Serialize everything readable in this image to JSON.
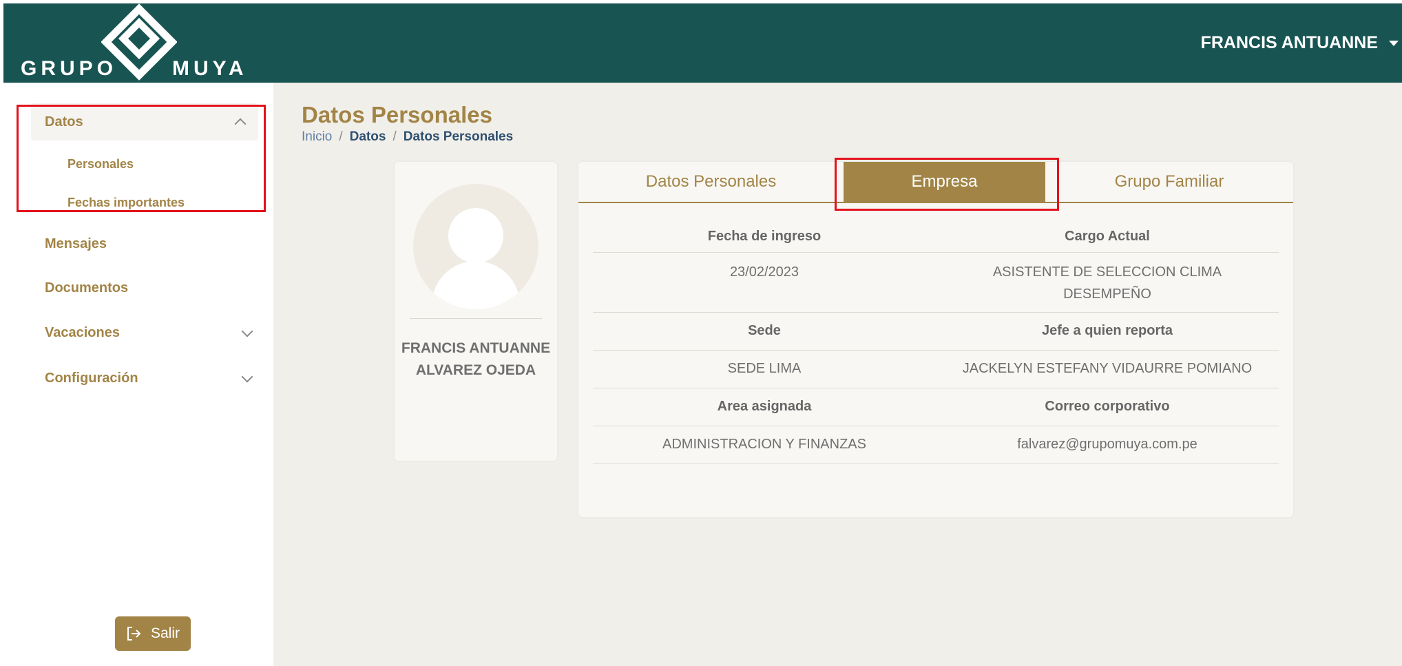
{
  "header": {
    "logo_left": "GRUPO",
    "logo_right": "MUYA",
    "user_name": "FRANCIS ANTUANNE",
    "bg_color": "#185452"
  },
  "sidebar": {
    "group": {
      "label": "Datos",
      "expanded": true
    },
    "subitems": [
      "Personales",
      "Fechas importantes"
    ],
    "items": [
      {
        "label": "Mensajes",
        "has_chevron": false
      },
      {
        "label": "Documentos",
        "has_chevron": false
      },
      {
        "label": "Vacaciones",
        "has_chevron": true
      },
      {
        "label": "Configuración",
        "has_chevron": true
      }
    ],
    "logout_label": "Salir"
  },
  "main": {
    "title": "Datos Personales",
    "breadcrumb": [
      "Inicio",
      "Datos",
      "Datos Personales"
    ],
    "profile": {
      "name": "FRANCIS ANTUANNE\nALVAREZ OJEDA"
    },
    "tabs": [
      {
        "label": "Datos Personales",
        "active": false
      },
      {
        "label": "Empresa",
        "active": true
      },
      {
        "label": "Grupo Familiar",
        "active": false
      }
    ],
    "fields": [
      {
        "head": [
          "Fecha de ingreso",
          "Cargo Actual"
        ],
        "value": [
          "23/02/2023",
          "ASISTENTE DE SELECCION CLIMA DESEMPEÑO"
        ]
      },
      {
        "head": [
          "Sede",
          "Jefe a quien reporta"
        ],
        "value": [
          "SEDE LIMA",
          "JACKELYN ESTEFANY VIDAURRE POMIANO"
        ]
      },
      {
        "head": [
          "Area asignada",
          "Correo corporativo"
        ],
        "value": [
          "ADMINISTRACION Y FINANZAS",
          "falvarez@grupomuya.com.pe"
        ]
      }
    ]
  },
  "colors": {
    "accent": "#a28446",
    "highlight": "#e3121b",
    "background": "#f1efea"
  }
}
